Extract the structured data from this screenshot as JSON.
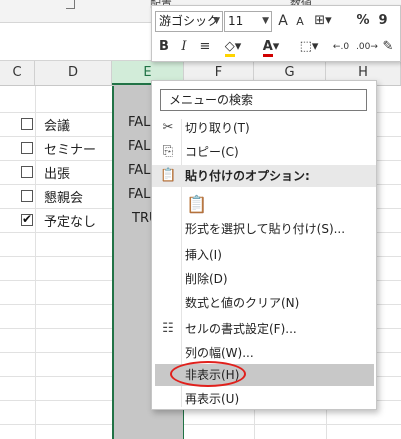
{
  "ribbon": {
    "group_alignment": "配置",
    "group_number": "数値"
  },
  "columns": [
    "C",
    "D",
    "E",
    "F",
    "G",
    "H"
  ],
  "rows": [
    {
      "checked": false,
      "d": "会議",
      "e": "FAL"
    },
    {
      "checked": false,
      "d": "セミナー",
      "e": "FAL"
    },
    {
      "checked": false,
      "d": "出張",
      "e": "FAL"
    },
    {
      "checked": false,
      "d": "懇親会",
      "e": "FAL"
    },
    {
      "checked": true,
      "d": "予定なし",
      "e": "TRU"
    }
  ],
  "mini_toolbar": {
    "font_name": "游ゴシック",
    "font_size": "11",
    "bold": "B",
    "italic": "I",
    "align_center": "≡",
    "percent": "%",
    "comma": "9",
    "grow_font": "A",
    "shrink_font": "A"
  },
  "context_menu": {
    "search_placeholder": "メニューの検索",
    "items": {
      "cut": "切り取り(T)",
      "copy": "コピー(C)",
      "paste_options": "貼り付けのオプション:",
      "paste_special": "形式を選択して貼り付け(S)...",
      "insert": "挿入(I)",
      "delete": "削除(D)",
      "clear_contents": "数式と値のクリア(N)",
      "format_cells": "セルの書式設定(F)...",
      "column_width": "列の幅(W)...",
      "hide": "非表示(H)",
      "unhide": "再表示(U)"
    }
  },
  "colors": {
    "accent": "#217346",
    "highlight_oval": "#e0201c"
  }
}
